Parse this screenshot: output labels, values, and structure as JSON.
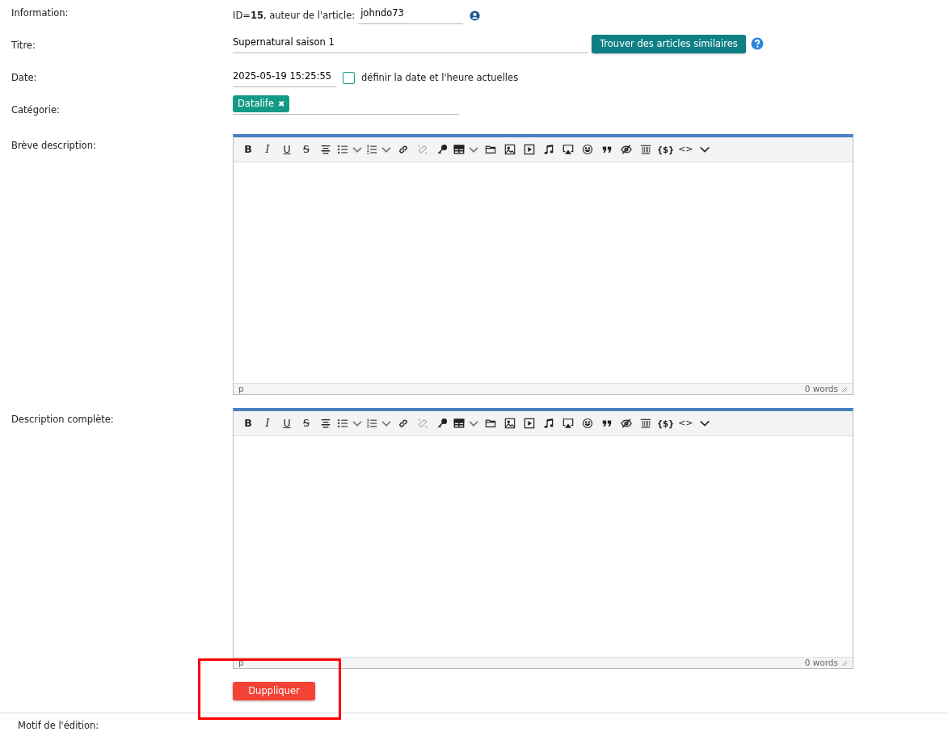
{
  "fields": [
    {
      "kind": "info",
      "label": "Information:",
      "id_text": "ID=**15**, auteur de l'article:",
      "author": "johndo73"
    },
    {
      "kind": "title",
      "label": "Titre:",
      "value": "Supernatural saison 1",
      "button": "Trouver des articles similaires"
    },
    {
      "kind": "date",
      "label": "Date:",
      "value": "2025-05-19 15:25:55",
      "checkbox_label": "définir la date et l'heure actuelles",
      "checked": false
    },
    {
      "kind": "category",
      "label": "Catégorie:",
      "tags": [
        {
          "label": "Datalife",
          "remove": "✖"
        }
      ]
    }
  ],
  "editors": [
    {
      "label": "Brève description:",
      "toolbar": [
        {
          "kind": "bold",
          "label": "B",
          "dropdown": false,
          "disabled": false
        },
        {
          "kind": "italic",
          "label": "I",
          "dropdown": false,
          "disabled": false
        },
        {
          "kind": "underline",
          "label": "U",
          "dropdown": false,
          "disabled": false
        },
        {
          "kind": "strike",
          "label": "S",
          "dropdown": false,
          "disabled": false
        },
        {
          "kind": "align",
          "dropdown": false,
          "disabled": false
        },
        {
          "kind": "bullets",
          "dropdown": true,
          "disabled": false
        },
        {
          "kind": "numbers",
          "dropdown": true,
          "disabled": false
        },
        {
          "kind": "link",
          "dropdown": false,
          "disabled": false
        },
        {
          "kind": "unlink",
          "dropdown": false,
          "disabled": true
        },
        {
          "kind": "key",
          "dropdown": false,
          "disabled": false
        },
        {
          "kind": "table",
          "dropdown": true,
          "disabled": false
        },
        {
          "kind": "folder",
          "dropdown": false,
          "disabled": false
        },
        {
          "kind": "image",
          "dropdown": false,
          "disabled": false
        },
        {
          "kind": "video",
          "dropdown": false,
          "disabled": false
        },
        {
          "kind": "music",
          "dropdown": false,
          "disabled": false
        },
        {
          "kind": "screen",
          "dropdown": false,
          "disabled": false
        },
        {
          "kind": "smiley",
          "dropdown": false,
          "disabled": false
        },
        {
          "kind": "quote",
          "dropdown": false,
          "disabled": false
        },
        {
          "kind": "hidden",
          "dropdown": false,
          "disabled": false
        },
        {
          "kind": "pagebreak",
          "dropdown": false,
          "disabled": false
        },
        {
          "kind": "vars",
          "label": "{$}",
          "dropdown": false,
          "disabled": false
        },
        {
          "kind": "source",
          "label": "<>",
          "dropdown": false,
          "disabled": false
        },
        {
          "kind": "more",
          "dropdown": false,
          "disabled": false
        }
      ],
      "path": "p",
      "count": "0 words"
    },
    {
      "label": "Description complète:",
      "toolbar": [
        {
          "kind": "bold",
          "label": "B",
          "dropdown": false,
          "disabled": false
        },
        {
          "kind": "italic",
          "label": "I",
          "dropdown": false,
          "disabled": false
        },
        {
          "kind": "underline",
          "label": "U",
          "dropdown": false,
          "disabled": false
        },
        {
          "kind": "strike",
          "label": "S",
          "dropdown": false,
          "disabled": false
        },
        {
          "kind": "align",
          "dropdown": false,
          "disabled": false
        },
        {
          "kind": "bullets",
          "dropdown": true,
          "disabled": false
        },
        {
          "kind": "numbers",
          "dropdown": true,
          "disabled": false
        },
        {
          "kind": "link",
          "dropdown": false,
          "disabled": false
        },
        {
          "kind": "unlink",
          "dropdown": false,
          "disabled": true
        },
        {
          "kind": "key",
          "dropdown": false,
          "disabled": false
        },
        {
          "kind": "table",
          "dropdown": true,
          "disabled": false
        },
        {
          "kind": "folder",
          "dropdown": false,
          "disabled": false
        },
        {
          "kind": "image",
          "dropdown": false,
          "disabled": false
        },
        {
          "kind": "video",
          "dropdown": false,
          "disabled": false
        },
        {
          "kind": "music",
          "dropdown": false,
          "disabled": false
        },
        {
          "kind": "screen",
          "dropdown": false,
          "disabled": false
        },
        {
          "kind": "smiley",
          "dropdown": false,
          "disabled": false
        },
        {
          "kind": "quote",
          "dropdown": false,
          "disabled": false
        },
        {
          "kind": "hidden",
          "dropdown": false,
          "disabled": false
        },
        {
          "kind": "pagebreak",
          "dropdown": false,
          "disabled": false
        },
        {
          "kind": "vars",
          "label": "{$}",
          "dropdown": false,
          "disabled": false
        },
        {
          "kind": "source",
          "label": "<>",
          "dropdown": false,
          "disabled": false
        },
        {
          "kind": "more",
          "dropdown": false,
          "disabled": false
        }
      ],
      "path": "p",
      "count": "0 words"
    }
  ],
  "duplicate_button": "Duppliquer",
  "next_label": "Motif de l'édition:"
}
